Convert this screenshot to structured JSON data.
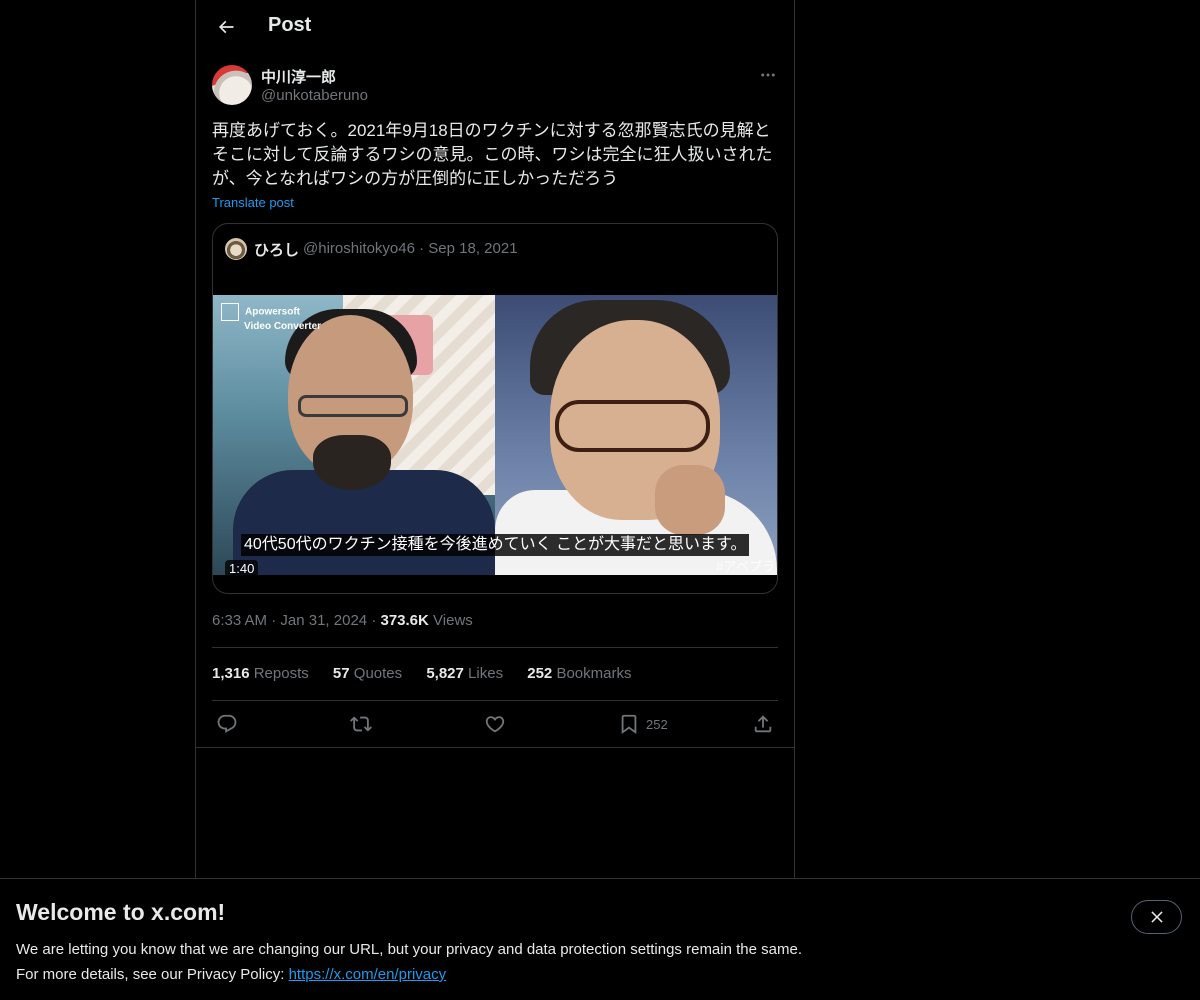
{
  "header": {
    "title": "Post",
    "back_icon": "arrow-left-icon"
  },
  "post": {
    "author_name": "中川淳一郎",
    "author_handle": "@unkotaberuno",
    "text_lines": [
      "再度あげておく。2021年9月18日のワクチンに対する忽那賢志氏の見解と",
      "そこに対して反論するワシの意見。この時、ワシは完全に狂人扱いされた",
      "が、今となればワシの方が圧倒的に正しかっただろう"
    ],
    "translate_label": "Translate post",
    "time": "6:33 AM",
    "date": "Jan 31, 2024",
    "views_count": "373.6K",
    "views_label": "Views"
  },
  "quote": {
    "name": "ひろし",
    "handle": "@hiroshitokyo46",
    "date": "Sep 18, 2021",
    "video": {
      "watermark_brand": "Apowersoft",
      "watermark_product": "Video Converter",
      "subtitle": "40代50代のワクチン接種を今後進めていく ことが大事だと思います。",
      "hashtag": "#アベプラ",
      "duration": "1:40"
    }
  },
  "stats": [
    {
      "count": "1,316",
      "label": "Reposts"
    },
    {
      "count": "57",
      "label": "Quotes"
    },
    {
      "count": "5,827",
      "label": "Likes"
    },
    {
      "count": "252",
      "label": "Bookmarks"
    }
  ],
  "actions": {
    "bookmark_count": "252"
  },
  "banner": {
    "title": "Welcome to x.com!",
    "line1": "We are letting you know that we are changing our URL, but your privacy and data protection settings remain the same.",
    "line2_prefix": "For more details, see our Privacy Policy: ",
    "link": "https://x.com/en/privacy"
  },
  "colors": {
    "background": "#000000",
    "text": "#e7e9ea",
    "muted": "#71767b",
    "link": "#1d9bf0",
    "border": "#2f3336"
  }
}
